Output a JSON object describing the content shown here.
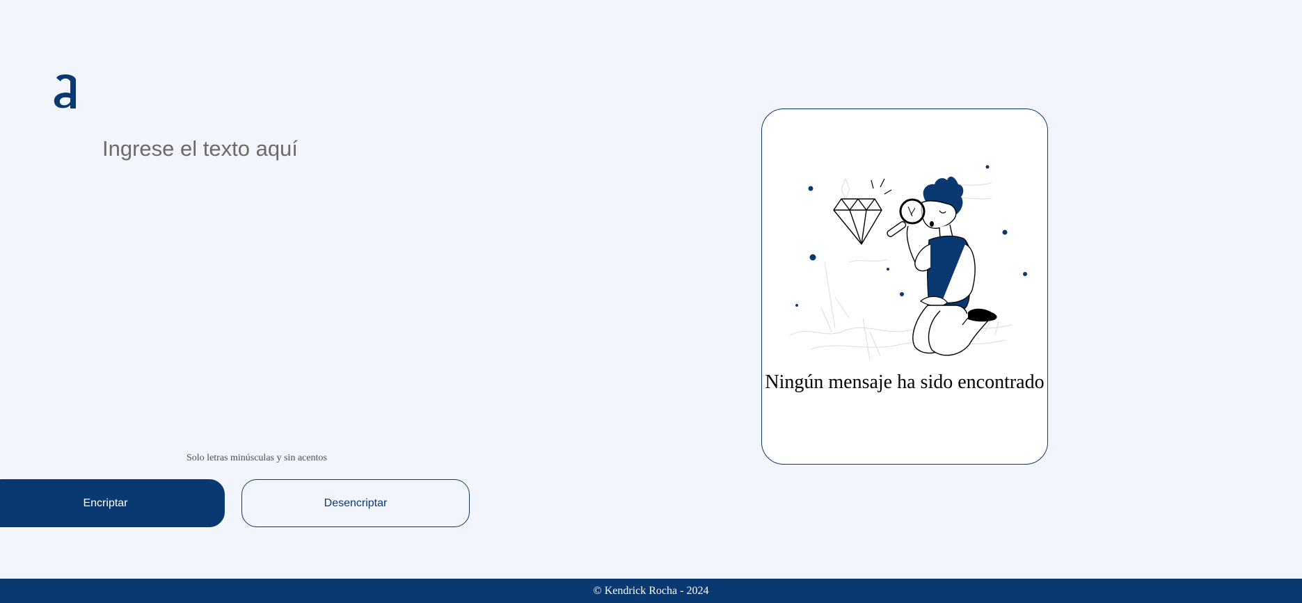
{
  "logo": {
    "icon": "alura-a-logo-icon"
  },
  "input": {
    "placeholder": "Ingrese el texto aquí",
    "value": ""
  },
  "hint": {
    "text": "Solo letras minúsculas y sin acentos",
    "icon": "info-icon"
  },
  "buttons": {
    "encrypt_label": "Encriptar",
    "decrypt_label": "Desencriptar"
  },
  "result_panel": {
    "illustration": "person-magnifying-glass-diamond-illustration",
    "message": "Ningún mensaje ha sido encontrado"
  },
  "footer": {
    "text": "© Kendrick Rocha - 2024"
  },
  "colors": {
    "primary": "#0A3871",
    "background": "#F3F5FC",
    "panel": "#FFFFFF"
  }
}
